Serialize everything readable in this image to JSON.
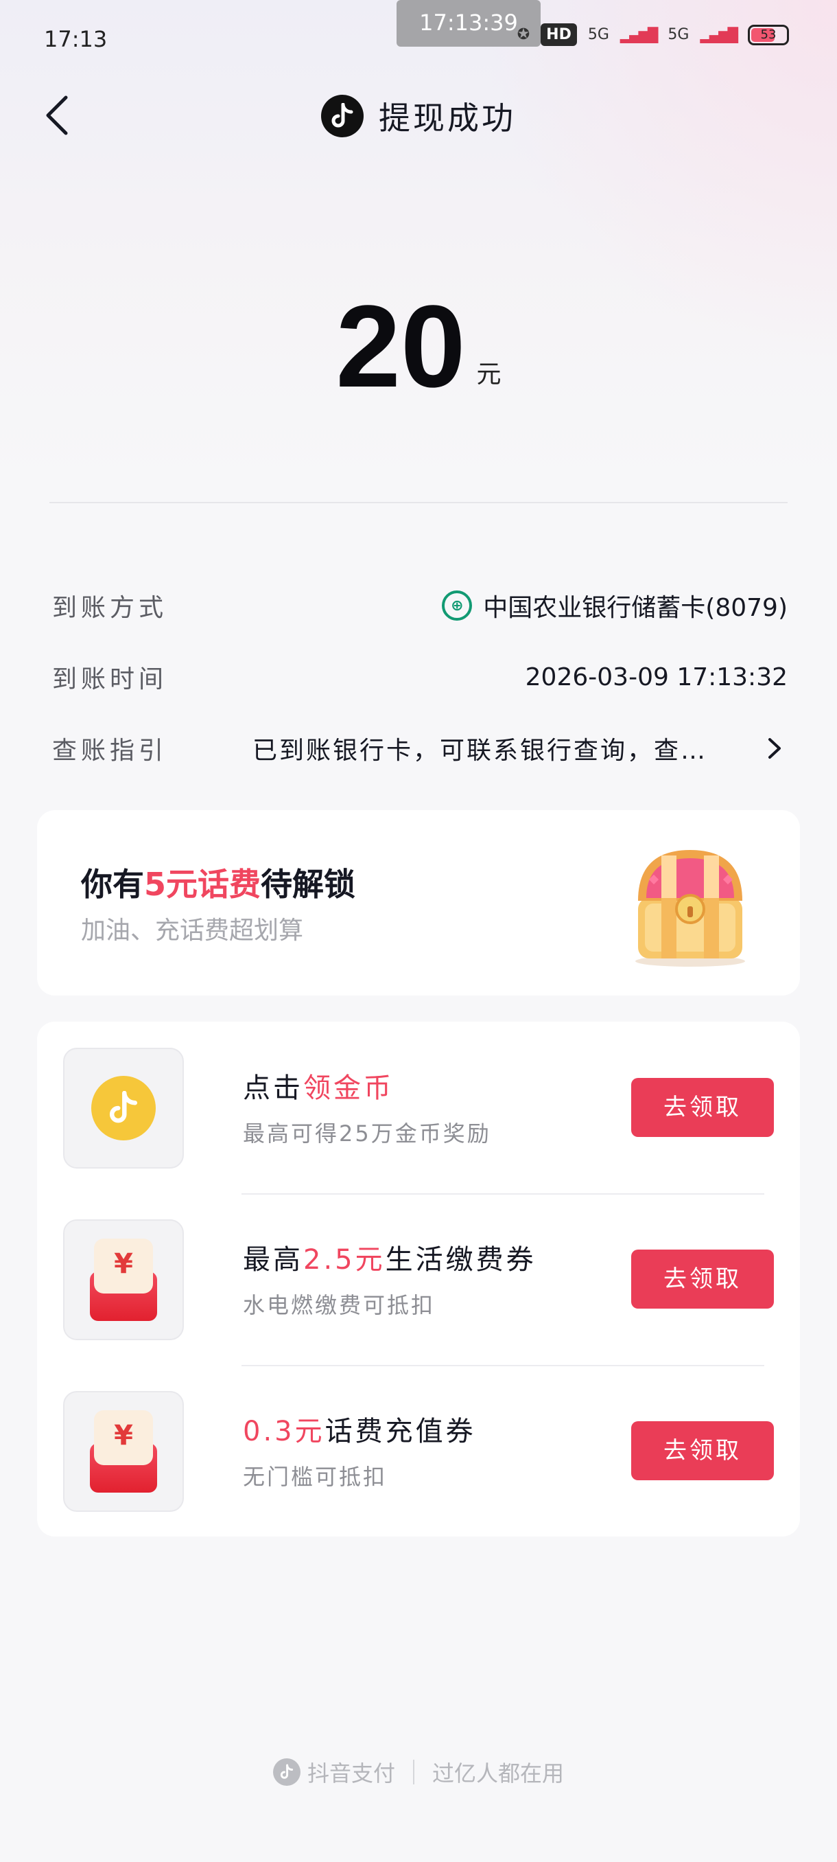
{
  "status_bar": {
    "time": "17:13",
    "center_time": "17:13:39",
    "hd": "HD",
    "network_1": "5G",
    "network_2": "5G",
    "battery": "53"
  },
  "nav": {
    "title": "提现成功"
  },
  "amount": {
    "value": "20",
    "unit": "元"
  },
  "details": {
    "method_label": "到账方式",
    "method_value": "中国农业银行储蓄卡(8079)",
    "time_label": "到账时间",
    "time_value": "2026-03-09 17:13:32",
    "guide_label": "查账指引",
    "guide_value": "已到账银行卡，可联系银行查询，查…"
  },
  "promo": {
    "title_prefix": "你有",
    "title_highlight": "5元话费",
    "title_suffix": "待解锁",
    "subtitle": "加油、充话费超划算"
  },
  "tasks": [
    {
      "title_prefix": "点击",
      "title_highlight": "领金币",
      "title_suffix": "",
      "subtitle": "最高可得25万金币奖励",
      "button": "去领取",
      "icon": "coin-icon"
    },
    {
      "title_prefix": "最高",
      "title_highlight": "2.5元",
      "title_suffix": "生活缴费券",
      "subtitle": "水电燃缴费可抵扣",
      "button": "去领取",
      "icon": "red-envelope-icon"
    },
    {
      "title_prefix": "",
      "title_highlight": "0.3元",
      "title_suffix": "话费充值券",
      "subtitle": "无门槛可抵扣",
      "button": "去领取",
      "icon": "red-envelope-icon"
    }
  ],
  "envelope_symbol": "¥",
  "footer": {
    "brand": "抖音支付",
    "slogan": "过亿人都在用"
  },
  "colors": {
    "accent": "#ea3d57",
    "highlight": "#f0465f",
    "bank_green": "#129a73"
  }
}
